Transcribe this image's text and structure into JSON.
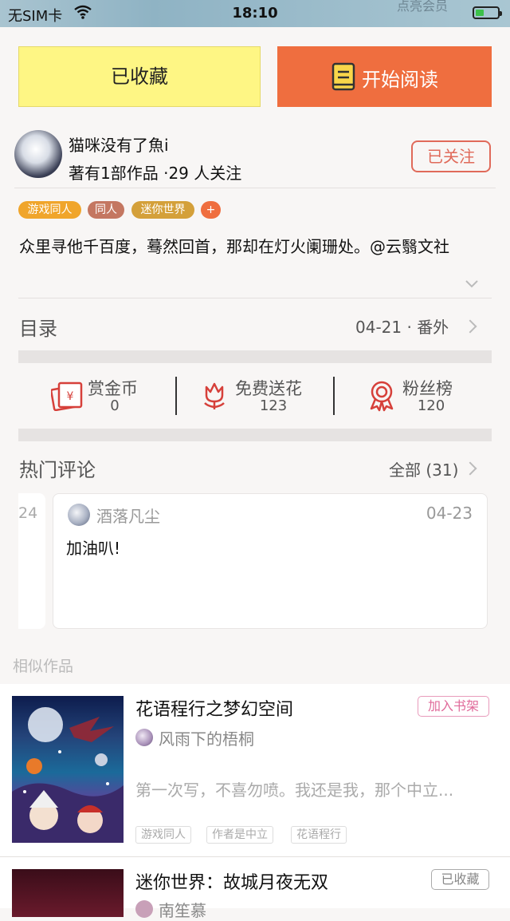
{
  "status_bar": {
    "carrier": "无SIM卡",
    "time": "18:10",
    "faded_text": "点亮会员"
  },
  "actions": {
    "collected_label": "已收藏",
    "read_label": "开始阅读"
  },
  "author": {
    "name": "猫咪没有了魚i",
    "meta": "著有1部作品 ·29 人关注",
    "follow_label": "已关注"
  },
  "tags": [
    {
      "label": "游戏同人",
      "color": "#f0a52b"
    },
    {
      "label": "同人",
      "color": "#c47761"
    },
    {
      "label": "迷你世界",
      "color": "#d4a03a"
    },
    {
      "label": "+",
      "color": "#ef6e3f"
    }
  ],
  "description": "众里寻他千百度，蓦然回首，那却在灯火阑珊处。@云翳文社",
  "catalog": {
    "title": "目录",
    "latest": "04-21 · 番外"
  },
  "stats": [
    {
      "label": "赏金币",
      "value": "0",
      "icon": "reward-envelope-icon"
    },
    {
      "label": "免费送花",
      "value": "123",
      "icon": "flower-icon"
    },
    {
      "label": "粉丝榜",
      "value": "120",
      "icon": "medal-icon"
    }
  ],
  "comments": {
    "title": "热门评论",
    "all_label": "全部 (31)",
    "prev_card_partial": "24",
    "items": [
      {
        "user": "酒落凡尘",
        "date": "04-23",
        "text": "加油叭!"
      }
    ]
  },
  "similar": {
    "title": "相似作品",
    "items": [
      {
        "title": "花语程行之梦幻空间",
        "author": "风雨下的梧桐",
        "desc": "第一次写，不喜勿喷。我还是我，那个中立...",
        "tags": [
          "游戏同人",
          "作者是中立",
          "花语程行"
        ],
        "action": "加入书架"
      },
      {
        "title": "迷你世界：故城月夜无双",
        "author": "南笙慕",
        "action": "已收藏"
      }
    ]
  },
  "colors": {
    "accent_orange": "#ef6e3f",
    "collected_yellow": "#fef684",
    "icon_red": "#d6403a"
  }
}
